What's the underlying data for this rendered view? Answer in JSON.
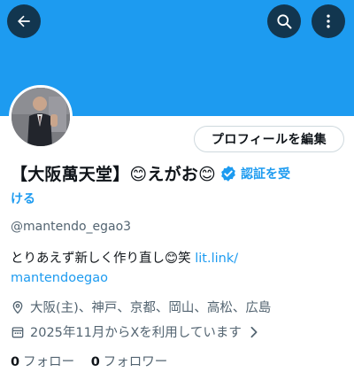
{
  "header": {
    "back_icon": "arrow-left-icon",
    "search_icon": "search-icon",
    "more_icon": "more-vertical-icon",
    "banner_color": "#1d9bf0"
  },
  "profile": {
    "edit_label": "プロフィールを編集",
    "display_name": "【大阪萬天堂】😊えがお😊",
    "verify_part1": "認証を受",
    "verify_part2": "ける",
    "handle": "@mantendo_egao3",
    "bio_text": "とりあえず新しく作り直し😊笑 ",
    "bio_link_part1": "lit.link/",
    "bio_link_part2": "mantendoegao",
    "location": "大阪(主)、神戸、京都、岡山、高松、広島",
    "joined": "2025年11月からXを利用しています",
    "following_count": "0",
    "following_label": "フォロー",
    "followers_count": "0",
    "followers_label": "フォロワー",
    "accent_color": "#1d9bf0"
  }
}
